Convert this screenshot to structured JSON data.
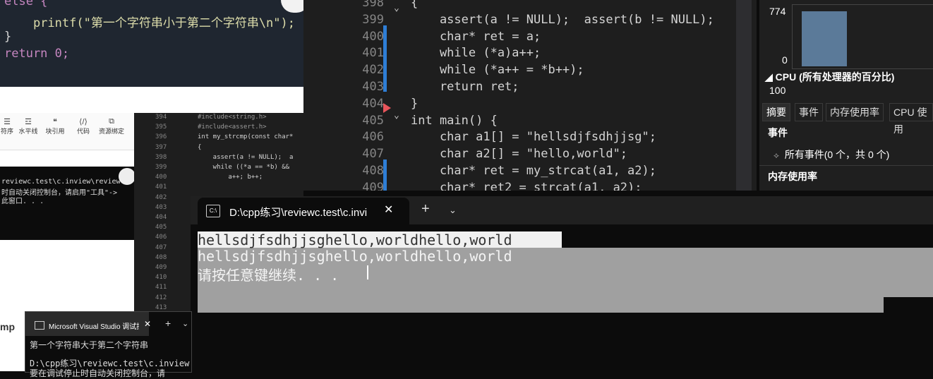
{
  "snippet": {
    "lines": [
      "else {",
      "    printf(\"第一个字符串小于第二个字符串\\n\");",
      "}",
      "return 0;"
    ]
  },
  "word_toolbar": {
    "items": [
      "符序",
      "水平线",
      "块引用",
      "代码",
      "资源绑定"
    ],
    "icons": [
      "list-icon",
      "hr-icon",
      "quote-icon",
      "code-icon",
      "bind-icon"
    ]
  },
  "small_console": {
    "lines": [
      "reviewc.test\\c.inview\\reviewc\\",
      "时自动关闭控制台，请启用\"工具\"->",
      "此窗口. . ."
    ]
  },
  "cmp_label": "mp",
  "small_editor": {
    "numbers": [
      "394",
      "395",
      "396",
      "397",
      "398",
      "399",
      "400",
      "401",
      "402",
      "403",
      "404",
      "405",
      "406",
      "407",
      "408",
      "409",
      "410",
      "411",
      "412",
      "413"
    ],
    "code": [
      "#include<string.h>",
      "#include<assert.h>",
      "int my_strcmp(const char*",
      "{",
      "    assert(a != NULL);  a",
      "    while ((*a == *b) &&",
      "        a++; b++;",
      "",
      "",
      "",
      "",
      "",
      "",
      "",
      "",
      "",
      "",
      "",
      "",
      ""
    ]
  },
  "small_vs": {
    "tab_title": "Microsoft Visual Studio 调试控制台",
    "lines": [
      "第一个字符串大于第二个字符串",
      "",
      "D:\\cpp练习\\reviewc.test\\c.inview",
      "要在调试停止时自动关闭控制台，请"
    ]
  },
  "editor": {
    "line_numbers": [
      "398",
      "399",
      "400",
      "401",
      "402",
      "403",
      "404",
      "405",
      "406",
      "407",
      "408",
      "409"
    ],
    "code_lines": [
      "{",
      "    assert(a != NULL);  assert(b != NULL);",
      "    char* ret = a;",
      "    while (*a)a++;",
      "    while (*a++ = *b++);",
      "    return ret;",
      "}",
      "int main() {",
      "    char a1[] = \"hellsdjfsdhjjsg\";",
      "    char a2[] = \"hello,world\";",
      "    char* ret = my_strcat(a1, a2);",
      "    char* ret2 = strcat(a1, a2);"
    ]
  },
  "diag": {
    "graph_top": "774",
    "graph_bottom": "0",
    "cpu_title": "◢ CPU (所有处理器的百分比)",
    "cpu_value": "100",
    "tabs": [
      "摘要",
      "事件",
      "内存使用率",
      "CPU 使用"
    ],
    "events_header": "事件",
    "all_events": "所有事件(0 个，共 0 个)",
    "memory_header": "内存使用率"
  },
  "terminal": {
    "tab_title": "D:\\cpp练习\\reviewc.test\\c.invi",
    "close_glyph": "✕",
    "plus_glyph": "+",
    "dropdown_glyph": "⌄",
    "lines": [
      "hellsdjfsdhjjsghello,worldhello,world",
      "hellsdjfsdhjjsghello,worldhello,world",
      "请按任意键继续. . . "
    ]
  }
}
